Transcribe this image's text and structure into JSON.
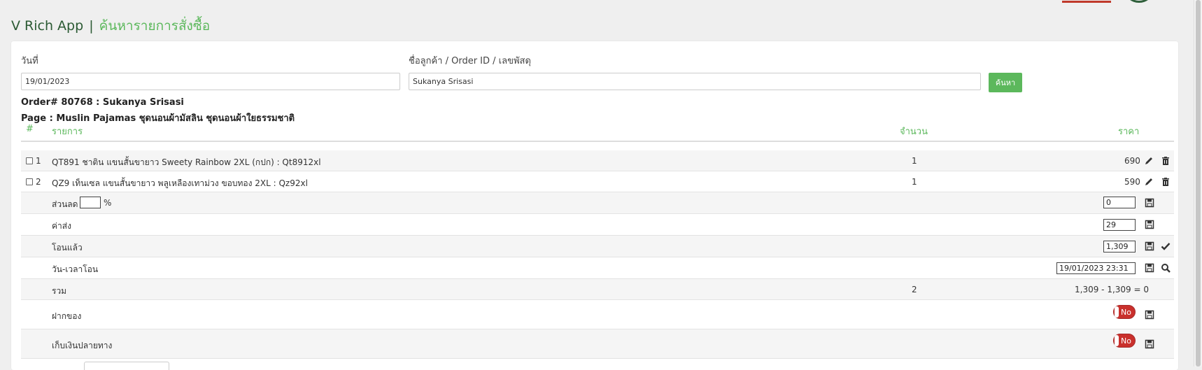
{
  "header": {
    "app_name": "V Rich App",
    "separator": "|",
    "page_title": "ค้นหารายการสั่งซื้อ"
  },
  "search": {
    "date_label": "วันที่",
    "date_value": "19/01/2023",
    "customer_label": "ชื่อลูกค้า / Order ID / เลขพัสดุ",
    "customer_value": "Sukanya Srisasi",
    "search_button": "ค้นหา"
  },
  "order": {
    "order_line": "Order# 80768 : Sukanya Srisasi",
    "page_line": "Page : Muslin Pajamas ชุดนอนผ้ามัสลิน ชุดนอนผ้าใยธรรมชาติ"
  },
  "table": {
    "headers": {
      "num": "#",
      "item": "รายการ",
      "qty": "จำนวน",
      "price": "ราคา"
    },
    "items": [
      {
        "num": "1",
        "name": "QT891 ชาติน แขนสั้นขายาว Sweety Rainbow 2XL (กปก) : Qt8912xl",
        "qty": "1",
        "price": "690"
      },
      {
        "num": "2",
        "name": "QZ9 เท็นเซล แขนสั้นขายาว พลูเหลืองเทาม่วง ขอบทอง 2XL : Qz92xl",
        "qty": "1",
        "price": "590"
      }
    ],
    "discount": {
      "label": "ส่วนลด",
      "percent_value": "",
      "percent_sign": "%",
      "value": "0"
    },
    "shipping": {
      "label": "ค่าส่ง",
      "value": "29"
    },
    "transferred": {
      "label": "โอนแล้ว",
      "value": "1,309"
    },
    "transfer_datetime": {
      "label": "วัน-เวลาโอน",
      "value": "19/01/2023 23:31"
    },
    "total": {
      "label": "รวม",
      "qty": "2",
      "value": "1,309 - 1,309 = 0"
    },
    "deposit": {
      "label": "ฝากของ",
      "toggle": "No"
    },
    "cod": {
      "label": "เก็บเงินปลายทาง",
      "toggle": "No"
    }
  },
  "colors": {
    "accent_green": "#5cb85c",
    "dark_green": "#2b5a33",
    "toggle_red": "#c9302c"
  }
}
